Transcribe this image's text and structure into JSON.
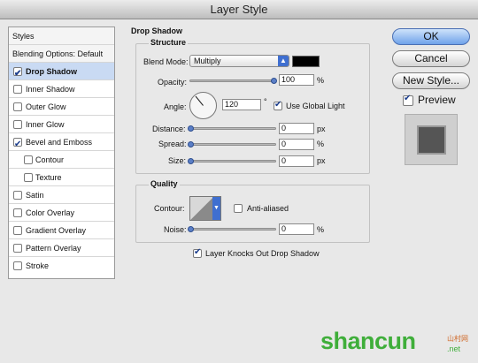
{
  "window": {
    "title": "Layer Style"
  },
  "sidebar": {
    "styles_header": "Styles",
    "blending_options": "Blending Options: Default",
    "items": [
      {
        "label": "Drop Shadow",
        "checked": true,
        "selected": true
      },
      {
        "label": "Inner Shadow",
        "checked": false
      },
      {
        "label": "Outer Glow",
        "checked": false
      },
      {
        "label": "Inner Glow",
        "checked": false
      },
      {
        "label": "Bevel and Emboss",
        "checked": true
      },
      {
        "label": "Contour",
        "checked": false,
        "indent": true
      },
      {
        "label": "Texture",
        "checked": false,
        "indent": true
      },
      {
        "label": "Satin",
        "checked": false
      },
      {
        "label": "Color Overlay",
        "checked": false
      },
      {
        "label": "Gradient Overlay",
        "checked": false
      },
      {
        "label": "Pattern Overlay",
        "checked": false
      },
      {
        "label": "Stroke",
        "checked": false
      }
    ]
  },
  "drop_shadow": {
    "section_title": "Drop Shadow",
    "structure_title": "Structure",
    "blend_mode_label": "Blend Mode:",
    "blend_mode_value": "Multiply",
    "shadow_color": "#000000",
    "opacity_label": "Opacity:",
    "opacity_value": "100",
    "opacity_unit": "%",
    "angle_label": "Angle:",
    "angle_value": "120",
    "angle_unit": "°",
    "use_global_light_label": "Use Global Light",
    "use_global_light_checked": true,
    "distance_label": "Distance:",
    "distance_value": "0",
    "distance_unit": "px",
    "spread_label": "Spread:",
    "spread_value": "0",
    "spread_unit": "%",
    "size_label": "Size:",
    "size_value": "0",
    "size_unit": "px"
  },
  "quality": {
    "title": "Quality",
    "contour_label": "Contour:",
    "anti_aliased_label": "Anti-aliased",
    "anti_aliased_checked": false,
    "noise_label": "Noise:",
    "noise_value": "0",
    "noise_unit": "%"
  },
  "knockout": {
    "label": "Layer Knocks Out Drop Shadow",
    "checked": true
  },
  "buttons": {
    "ok": "OK",
    "cancel": "Cancel",
    "new_style": "New Style...",
    "preview_label": "Preview",
    "preview_checked": true
  },
  "watermark": {
    "main": "shancun",
    "sub": "山村网",
    "domain": ".net"
  },
  "colors": {
    "selection": "#c9daf3",
    "accent": "#5b7fc7",
    "primary_button": "#6fa2ea",
    "watermark": "#3fae3a"
  }
}
